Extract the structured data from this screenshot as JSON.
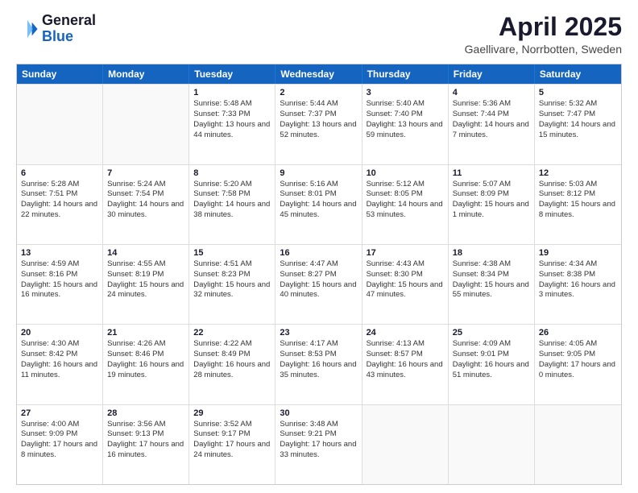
{
  "header": {
    "logo_general": "General",
    "logo_blue": "Blue",
    "title": "April 2025",
    "location": "Gaellivare, Norrbotten, Sweden"
  },
  "days_of_week": [
    "Sunday",
    "Monday",
    "Tuesday",
    "Wednesday",
    "Thursday",
    "Friday",
    "Saturday"
  ],
  "rows": [
    [
      {
        "day": "",
        "sunrise": "",
        "sunset": "",
        "daylight": "",
        "empty": true
      },
      {
        "day": "",
        "sunrise": "",
        "sunset": "",
        "daylight": "",
        "empty": true
      },
      {
        "day": "1",
        "sunrise": "Sunrise: 5:48 AM",
        "sunset": "Sunset: 7:33 PM",
        "daylight": "Daylight: 13 hours and 44 minutes.",
        "empty": false
      },
      {
        "day": "2",
        "sunrise": "Sunrise: 5:44 AM",
        "sunset": "Sunset: 7:37 PM",
        "daylight": "Daylight: 13 hours and 52 minutes.",
        "empty": false
      },
      {
        "day": "3",
        "sunrise": "Sunrise: 5:40 AM",
        "sunset": "Sunset: 7:40 PM",
        "daylight": "Daylight: 13 hours and 59 minutes.",
        "empty": false
      },
      {
        "day": "4",
        "sunrise": "Sunrise: 5:36 AM",
        "sunset": "Sunset: 7:44 PM",
        "daylight": "Daylight: 14 hours and 7 minutes.",
        "empty": false
      },
      {
        "day": "5",
        "sunrise": "Sunrise: 5:32 AM",
        "sunset": "Sunset: 7:47 PM",
        "daylight": "Daylight: 14 hours and 15 minutes.",
        "empty": false
      }
    ],
    [
      {
        "day": "6",
        "sunrise": "Sunrise: 5:28 AM",
        "sunset": "Sunset: 7:51 PM",
        "daylight": "Daylight: 14 hours and 22 minutes.",
        "empty": false
      },
      {
        "day": "7",
        "sunrise": "Sunrise: 5:24 AM",
        "sunset": "Sunset: 7:54 PM",
        "daylight": "Daylight: 14 hours and 30 minutes.",
        "empty": false
      },
      {
        "day": "8",
        "sunrise": "Sunrise: 5:20 AM",
        "sunset": "Sunset: 7:58 PM",
        "daylight": "Daylight: 14 hours and 38 minutes.",
        "empty": false
      },
      {
        "day": "9",
        "sunrise": "Sunrise: 5:16 AM",
        "sunset": "Sunset: 8:01 PM",
        "daylight": "Daylight: 14 hours and 45 minutes.",
        "empty": false
      },
      {
        "day": "10",
        "sunrise": "Sunrise: 5:12 AM",
        "sunset": "Sunset: 8:05 PM",
        "daylight": "Daylight: 14 hours and 53 minutes.",
        "empty": false
      },
      {
        "day": "11",
        "sunrise": "Sunrise: 5:07 AM",
        "sunset": "Sunset: 8:09 PM",
        "daylight": "Daylight: 15 hours and 1 minute.",
        "empty": false
      },
      {
        "day": "12",
        "sunrise": "Sunrise: 5:03 AM",
        "sunset": "Sunset: 8:12 PM",
        "daylight": "Daylight: 15 hours and 8 minutes.",
        "empty": false
      }
    ],
    [
      {
        "day": "13",
        "sunrise": "Sunrise: 4:59 AM",
        "sunset": "Sunset: 8:16 PM",
        "daylight": "Daylight: 15 hours and 16 minutes.",
        "empty": false
      },
      {
        "day": "14",
        "sunrise": "Sunrise: 4:55 AM",
        "sunset": "Sunset: 8:19 PM",
        "daylight": "Daylight: 15 hours and 24 minutes.",
        "empty": false
      },
      {
        "day": "15",
        "sunrise": "Sunrise: 4:51 AM",
        "sunset": "Sunset: 8:23 PM",
        "daylight": "Daylight: 15 hours and 32 minutes.",
        "empty": false
      },
      {
        "day": "16",
        "sunrise": "Sunrise: 4:47 AM",
        "sunset": "Sunset: 8:27 PM",
        "daylight": "Daylight: 15 hours and 40 minutes.",
        "empty": false
      },
      {
        "day": "17",
        "sunrise": "Sunrise: 4:43 AM",
        "sunset": "Sunset: 8:30 PM",
        "daylight": "Daylight: 15 hours and 47 minutes.",
        "empty": false
      },
      {
        "day": "18",
        "sunrise": "Sunrise: 4:38 AM",
        "sunset": "Sunset: 8:34 PM",
        "daylight": "Daylight: 15 hours and 55 minutes.",
        "empty": false
      },
      {
        "day": "19",
        "sunrise": "Sunrise: 4:34 AM",
        "sunset": "Sunset: 8:38 PM",
        "daylight": "Daylight: 16 hours and 3 minutes.",
        "empty": false
      }
    ],
    [
      {
        "day": "20",
        "sunrise": "Sunrise: 4:30 AM",
        "sunset": "Sunset: 8:42 PM",
        "daylight": "Daylight: 16 hours and 11 minutes.",
        "empty": false
      },
      {
        "day": "21",
        "sunrise": "Sunrise: 4:26 AM",
        "sunset": "Sunset: 8:46 PM",
        "daylight": "Daylight: 16 hours and 19 minutes.",
        "empty": false
      },
      {
        "day": "22",
        "sunrise": "Sunrise: 4:22 AM",
        "sunset": "Sunset: 8:49 PM",
        "daylight": "Daylight: 16 hours and 28 minutes.",
        "empty": false
      },
      {
        "day": "23",
        "sunrise": "Sunrise: 4:17 AM",
        "sunset": "Sunset: 8:53 PM",
        "daylight": "Daylight: 16 hours and 35 minutes.",
        "empty": false
      },
      {
        "day": "24",
        "sunrise": "Sunrise: 4:13 AM",
        "sunset": "Sunset: 8:57 PM",
        "daylight": "Daylight: 16 hours and 43 minutes.",
        "empty": false
      },
      {
        "day": "25",
        "sunrise": "Sunrise: 4:09 AM",
        "sunset": "Sunset: 9:01 PM",
        "daylight": "Daylight: 16 hours and 51 minutes.",
        "empty": false
      },
      {
        "day": "26",
        "sunrise": "Sunrise: 4:05 AM",
        "sunset": "Sunset: 9:05 PM",
        "daylight": "Daylight: 17 hours and 0 minutes.",
        "empty": false
      }
    ],
    [
      {
        "day": "27",
        "sunrise": "Sunrise: 4:00 AM",
        "sunset": "Sunset: 9:09 PM",
        "daylight": "Daylight: 17 hours and 8 minutes.",
        "empty": false
      },
      {
        "day": "28",
        "sunrise": "Sunrise: 3:56 AM",
        "sunset": "Sunset: 9:13 PM",
        "daylight": "Daylight: 17 hours and 16 minutes.",
        "empty": false
      },
      {
        "day": "29",
        "sunrise": "Sunrise: 3:52 AM",
        "sunset": "Sunset: 9:17 PM",
        "daylight": "Daylight: 17 hours and 24 minutes.",
        "empty": false
      },
      {
        "day": "30",
        "sunrise": "Sunrise: 3:48 AM",
        "sunset": "Sunset: 9:21 PM",
        "daylight": "Daylight: 17 hours and 33 minutes.",
        "empty": false
      },
      {
        "day": "",
        "sunrise": "",
        "sunset": "",
        "daylight": "",
        "empty": true
      },
      {
        "day": "",
        "sunrise": "",
        "sunset": "",
        "daylight": "",
        "empty": true
      },
      {
        "day": "",
        "sunrise": "",
        "sunset": "",
        "daylight": "",
        "empty": true
      }
    ]
  ]
}
